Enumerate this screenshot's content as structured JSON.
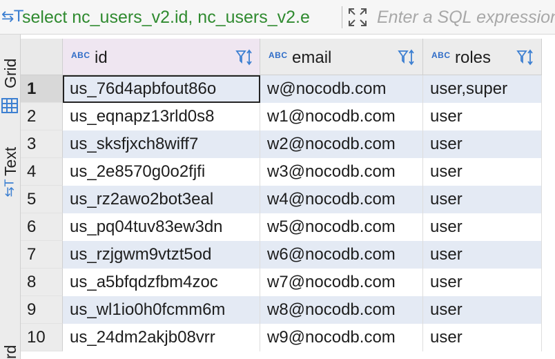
{
  "query_bar": {
    "sql_icon": "text-cursor-icon",
    "sql_text": "select nc_users_v2.id, nc_users_v2.e",
    "expand_icon": "expand-icon",
    "filter_placeholder": "Enter a SQL expression to filter results"
  },
  "side_tabs": [
    {
      "label": "Grid",
      "icon": "grid-icon"
    },
    {
      "label": "Text",
      "icon": "text-cursor-icon"
    },
    {
      "label": "rd",
      "icon": ""
    }
  ],
  "columns": [
    {
      "name": "id",
      "type_badge": "ABC",
      "icon": "key-column-icon"
    },
    {
      "name": "email",
      "type_badge": "ABC",
      "icon": "text-column-icon"
    },
    {
      "name": "roles",
      "type_badge": "ABC",
      "icon": "text-column-icon"
    }
  ],
  "rows": [
    {
      "num": "1",
      "id": "us_76d4apbfout86o",
      "email": "w@nocodb.com",
      "roles": "user,super"
    },
    {
      "num": "2",
      "id": "us_eqnapz13rld0s8",
      "email": "w1@nocodb.com",
      "roles": "user"
    },
    {
      "num": "3",
      "id": "us_sksfjxch8wiff7",
      "email": "w2@nocodb.com",
      "roles": "user"
    },
    {
      "num": "4",
      "id": "us_2e8570g0o2fjfi",
      "email": "w3@nocodb.com",
      "roles": "user"
    },
    {
      "num": "5",
      "id": "us_rz2awo2bot3eal",
      "email": "w4@nocodb.com",
      "roles": "user"
    },
    {
      "num": "6",
      "id": "us_pq04tuv83ew3dn",
      "email": "w5@nocodb.com",
      "roles": "user"
    },
    {
      "num": "7",
      "id": "us_rzjgwm9vtzt5od",
      "email": "w6@nocodb.com",
      "roles": "user"
    },
    {
      "num": "8",
      "id": "us_a5bfqdzfbm4zoc",
      "email": "w7@nocodb.com",
      "roles": "user"
    },
    {
      "num": "9",
      "id": "us_wl1io0h0fcmm6m",
      "email": "w8@nocodb.com",
      "roles": "user"
    },
    {
      "num": "10",
      "id": "us_24dm2akjb08vrr",
      "email": "w9@nocodb.com",
      "roles": "user"
    }
  ],
  "colors": {
    "sql_text": "#2f8a2f",
    "accent": "#2e6cc7",
    "alt_row": "#e4eaf4",
    "id_header": "#efe6f1"
  }
}
